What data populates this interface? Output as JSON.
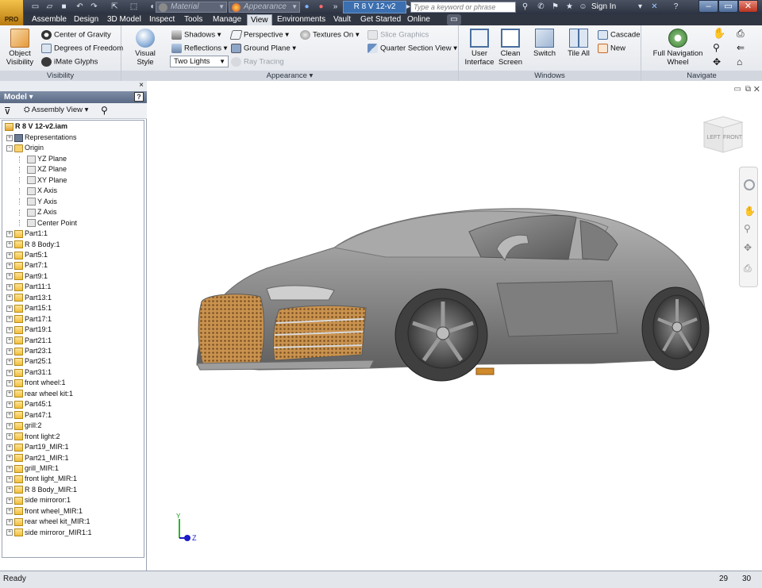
{
  "qat": {
    "material": "Material",
    "appearance": "Appearance",
    "doc_title": "R 8 V 12-v2",
    "search_placeholder": "Type a keyword or phrase",
    "sign_in": "Sign In"
  },
  "app_button": {
    "label": "PRO"
  },
  "tabs": [
    "Assemble",
    "Design",
    "3D Model",
    "Inspect",
    "Tools",
    "Manage",
    "View",
    "Environments",
    "Vault",
    "Get Started",
    "Online"
  ],
  "active_tab": "View",
  "ribbon": {
    "visibility": {
      "title": "Visibility",
      "object_visibility": "Object Visibility",
      "center_of_gravity": "Center of Gravity",
      "degrees_of_freedom": "Degrees of Freedom",
      "imate_glyphs": "iMate Glyphs"
    },
    "appearance": {
      "title": "Appearance",
      "visual_style": "Visual Style",
      "shadows": "Shadows",
      "reflections": "Reflections",
      "lighting": "Two Lights",
      "perspective": "Perspective",
      "ground_plane": "Ground Plane",
      "ray_tracing": "Ray Tracing",
      "textures_on": "Textures On",
      "slice_graphics": "Slice Graphics",
      "quarter_section_view": "Quarter Section View"
    },
    "windows": {
      "title": "Windows",
      "user_interface": "User Interface",
      "clean_screen": "Clean Screen",
      "switch": "Switch",
      "tile_all": "Tile All",
      "cascade": "Cascade",
      "new": "New"
    },
    "navigate": {
      "title": "Navigate",
      "full_navigation_wheel": "Full Navigation Wheel"
    }
  },
  "browser": {
    "title": "Model",
    "view_mode": "Assembly View",
    "root": "R 8 V 12-v2.iam",
    "items": [
      {
        "label": "Representations",
        "icon": "representations-icon",
        "indent": 1,
        "expander": "+"
      },
      {
        "label": "Origin",
        "icon": "folder-icon",
        "indent": 1,
        "expander": "-"
      },
      {
        "label": "YZ Plane",
        "icon": "plane-icon",
        "indent": 2,
        "expander": ""
      },
      {
        "label": "XZ Plane",
        "icon": "plane-icon",
        "indent": 2,
        "expander": ""
      },
      {
        "label": "XY Plane",
        "icon": "plane-icon",
        "indent": 2,
        "expander": ""
      },
      {
        "label": "X Axis",
        "icon": "axis-icon",
        "indent": 2,
        "expander": ""
      },
      {
        "label": "Y Axis",
        "icon": "axis-icon",
        "indent": 2,
        "expander": ""
      },
      {
        "label": "Z Axis",
        "icon": "axis-icon",
        "indent": 2,
        "expander": ""
      },
      {
        "label": "Center Point",
        "icon": "point-icon",
        "indent": 2,
        "expander": ""
      },
      {
        "label": "Part1:1",
        "icon": "part-icon",
        "indent": 1,
        "expander": "+"
      },
      {
        "label": "R 8 Body:1",
        "icon": "part-icon",
        "indent": 1,
        "expander": "+"
      },
      {
        "label": "Part5:1",
        "icon": "part-icon",
        "indent": 1,
        "expander": "+"
      },
      {
        "label": "Part7:1",
        "icon": "part-icon",
        "indent": 1,
        "expander": "+"
      },
      {
        "label": "Part9:1",
        "icon": "part-icon",
        "indent": 1,
        "expander": "+"
      },
      {
        "label": "Part11:1",
        "icon": "part-icon",
        "indent": 1,
        "expander": "+"
      },
      {
        "label": "Part13:1",
        "icon": "part-icon",
        "indent": 1,
        "expander": "+"
      },
      {
        "label": "Part15:1",
        "icon": "part-icon",
        "indent": 1,
        "expander": "+"
      },
      {
        "label": "Part17:1",
        "icon": "part-icon",
        "indent": 1,
        "expander": "+"
      },
      {
        "label": "Part19:1",
        "icon": "part-icon",
        "indent": 1,
        "expander": "+"
      },
      {
        "label": "Part21:1",
        "icon": "part-icon",
        "indent": 1,
        "expander": "+"
      },
      {
        "label": "Part23:1",
        "icon": "part-icon",
        "indent": 1,
        "expander": "+"
      },
      {
        "label": "Part25:1",
        "icon": "part-icon",
        "indent": 1,
        "expander": "+"
      },
      {
        "label": "Part31:1",
        "icon": "part-icon",
        "indent": 1,
        "expander": "+"
      },
      {
        "label": "front wheel:1",
        "icon": "part-icon",
        "indent": 1,
        "expander": "+"
      },
      {
        "label": "rear wheel kit:1",
        "icon": "part-icon",
        "indent": 1,
        "expander": "+"
      },
      {
        "label": "Part45:1",
        "icon": "part-icon",
        "indent": 1,
        "expander": "+"
      },
      {
        "label": "Part47:1",
        "icon": "part-icon",
        "indent": 1,
        "expander": "+"
      },
      {
        "label": "grill:2",
        "icon": "part-icon",
        "indent": 1,
        "expander": "+"
      },
      {
        "label": "front light:2",
        "icon": "part-icon",
        "indent": 1,
        "expander": "+"
      },
      {
        "label": "Part19_MIR:1",
        "icon": "part-icon",
        "indent": 1,
        "expander": "+"
      },
      {
        "label": "Part21_MIR:1",
        "icon": "part-icon",
        "indent": 1,
        "expander": "+"
      },
      {
        "label": "grill_MIR:1",
        "icon": "part-icon",
        "indent": 1,
        "expander": "+"
      },
      {
        "label": "front light_MIR:1",
        "icon": "part-icon",
        "indent": 1,
        "expander": "+"
      },
      {
        "label": "R 8 Body_MIR:1",
        "icon": "part-icon",
        "indent": 1,
        "expander": "+"
      },
      {
        "label": "side mirroror:1",
        "icon": "part-icon",
        "indent": 1,
        "expander": "+"
      },
      {
        "label": "front wheel_MIR:1",
        "icon": "part-icon",
        "indent": 1,
        "expander": "+"
      },
      {
        "label": "rear wheel kit_MIR:1",
        "icon": "part-icon",
        "indent": 1,
        "expander": "+"
      },
      {
        "label": "side mirroror_MIR1:1",
        "icon": "part-icon",
        "indent": 1,
        "expander": "+"
      }
    ]
  },
  "viewcube": {
    "left": "LEFT",
    "front": "FRONT"
  },
  "triad": {
    "y": "Y",
    "z": "Z"
  },
  "status": {
    "text": "Ready",
    "value1": "29",
    "value2": "30"
  },
  "colors": {
    "ribbon_bg": "#e3e6eb",
    "title_bar": "#2c3240",
    "doc_tab": "#3b6fb0",
    "car_body": "#8f8f8f",
    "grill": "#c9924e"
  }
}
